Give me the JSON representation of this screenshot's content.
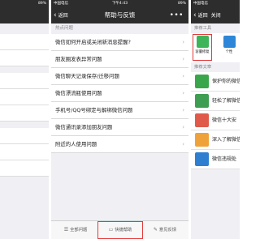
{
  "left_phone": {
    "status": {
      "carrier": "",
      "battery": "89%"
    }
  },
  "middle_phone": {
    "status": {
      "carrier": "中国电信",
      "time": "下午4:43",
      "battery": "89%"
    },
    "nav": {
      "back": "返回",
      "title": "帮助与反馈",
      "more": "•••"
    },
    "section_title": "热点问题",
    "questions": [
      "微信如何开启或关闭新消息提醒?",
      "朋友圈发表异常问题",
      "微信聊天记录保存/迁移问题",
      "微信漂流瓶使用问题",
      "手机号/QQ号绑定与解绑微信问题",
      "微信通讯录添加朋友问题",
      "附近的人使用问题"
    ],
    "tabbar": {
      "all": "全部问题",
      "quick": "快捷帮助",
      "feedback": "意见反馈"
    }
  },
  "right_phone": {
    "status": {
      "carrier": "中国电信"
    },
    "nav": {
      "back": "返回",
      "close": "关闭"
    },
    "tools_title": "推荐工具",
    "tools": [
      {
        "label": "容量修复",
        "icon": "phone-repair-icon",
        "color": "#3db35a"
      },
      {
        "label": "个性",
        "icon": "personal-icon",
        "color": "#2e86d8"
      }
    ],
    "articles_title": "推荐文章",
    "articles": [
      {
        "text": "保护你的微信",
        "icon": "shield-icon",
        "color": "#3aa64c"
      },
      {
        "text": "轻松了解微信",
        "icon": "grid-icon",
        "color": "#3d9e51"
      },
      {
        "text": "微信十大安",
        "icon": "gift-icon",
        "color": "#e05a4a"
      },
      {
        "text": "深入了解微信",
        "icon": "book-icon",
        "color": "#f0a23a"
      },
      {
        "text": "微信违规处",
        "icon": "person-icon",
        "color": "#2f7fd0"
      }
    ]
  }
}
